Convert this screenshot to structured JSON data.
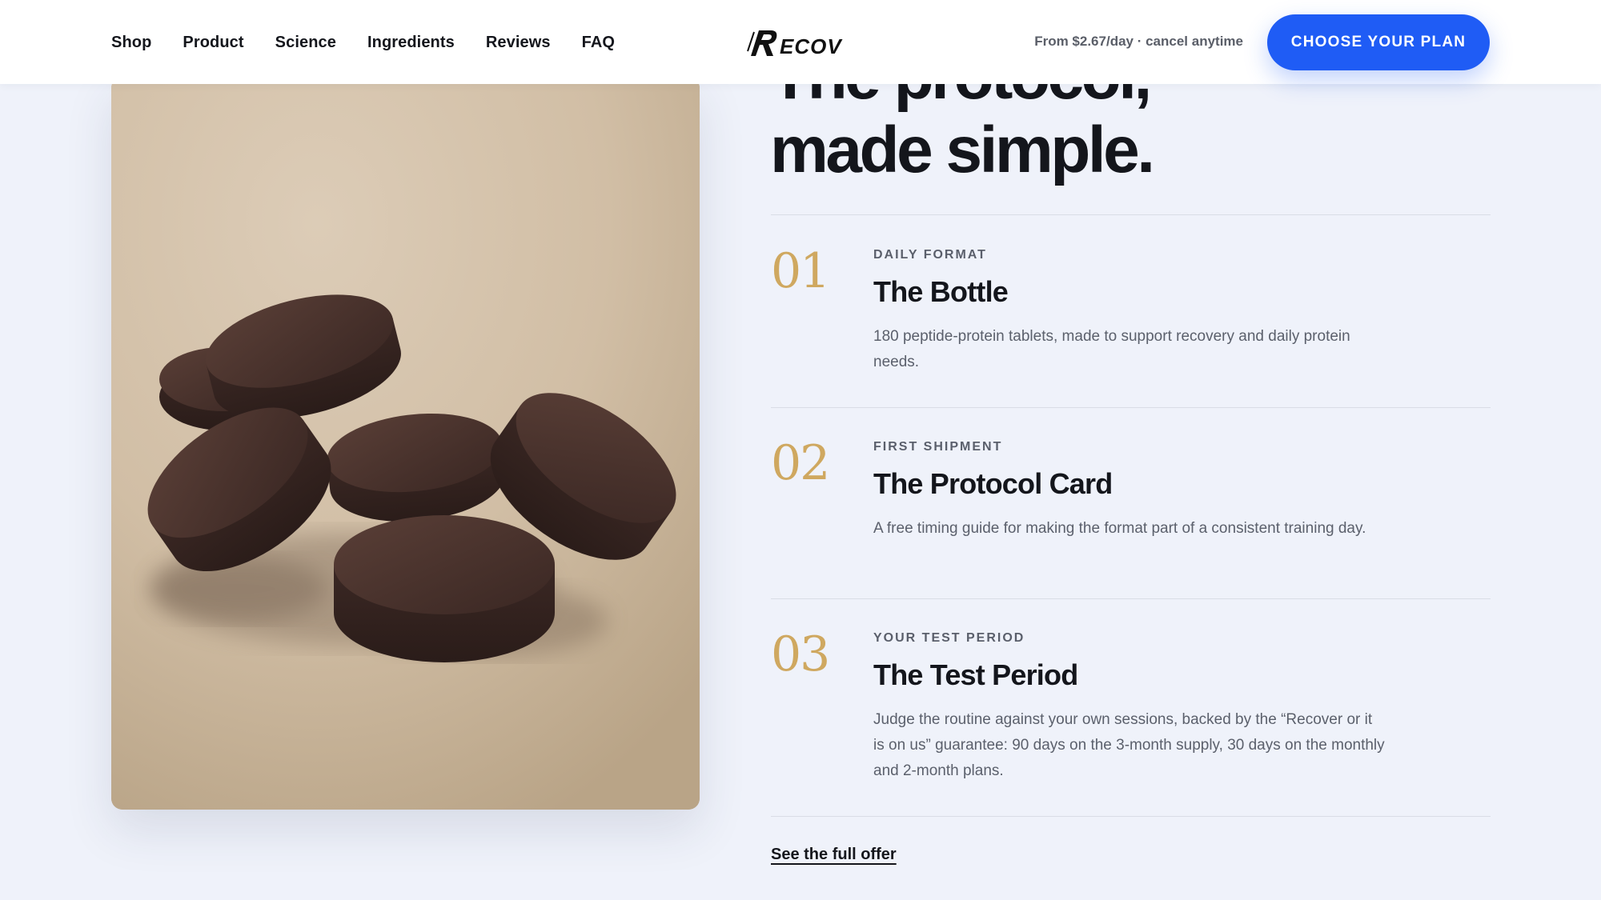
{
  "header": {
    "nav": [
      "Shop",
      "Product",
      "Science",
      "Ingredients",
      "Reviews",
      "FAQ"
    ],
    "logo_text": "RECOV",
    "price_note": "From $2.67/day · cancel anytime",
    "cta_label": "CHOOSE YOUR PLAN"
  },
  "hero": {
    "headline_line1": "The protocol,",
    "headline_line2": "made simple."
  },
  "steps": [
    {
      "number": "01",
      "kicker": "DAILY FORMAT",
      "title": "The Bottle",
      "description": "180 peptide-protein tablets, made to support recovery and daily protein needs."
    },
    {
      "number": "02",
      "kicker": "FIRST SHIPMENT",
      "title": "The Protocol Card",
      "description": "A free timing guide for making the format part of a consistent training day."
    },
    {
      "number": "03",
      "kicker": "YOUR TEST PERIOD",
      "title": "The Test Period",
      "description": "Judge the routine against your own sessions, backed by the “Recover or it is on us” guarantee: 90 days on the 3-month supply, 30 days on the monthly and 2-month plans."
    }
  ],
  "offer_link": "See the full offer",
  "colors": {
    "accent": "#1f5cf5",
    "step_number": "#cfa860",
    "background": "#eff2fa"
  }
}
